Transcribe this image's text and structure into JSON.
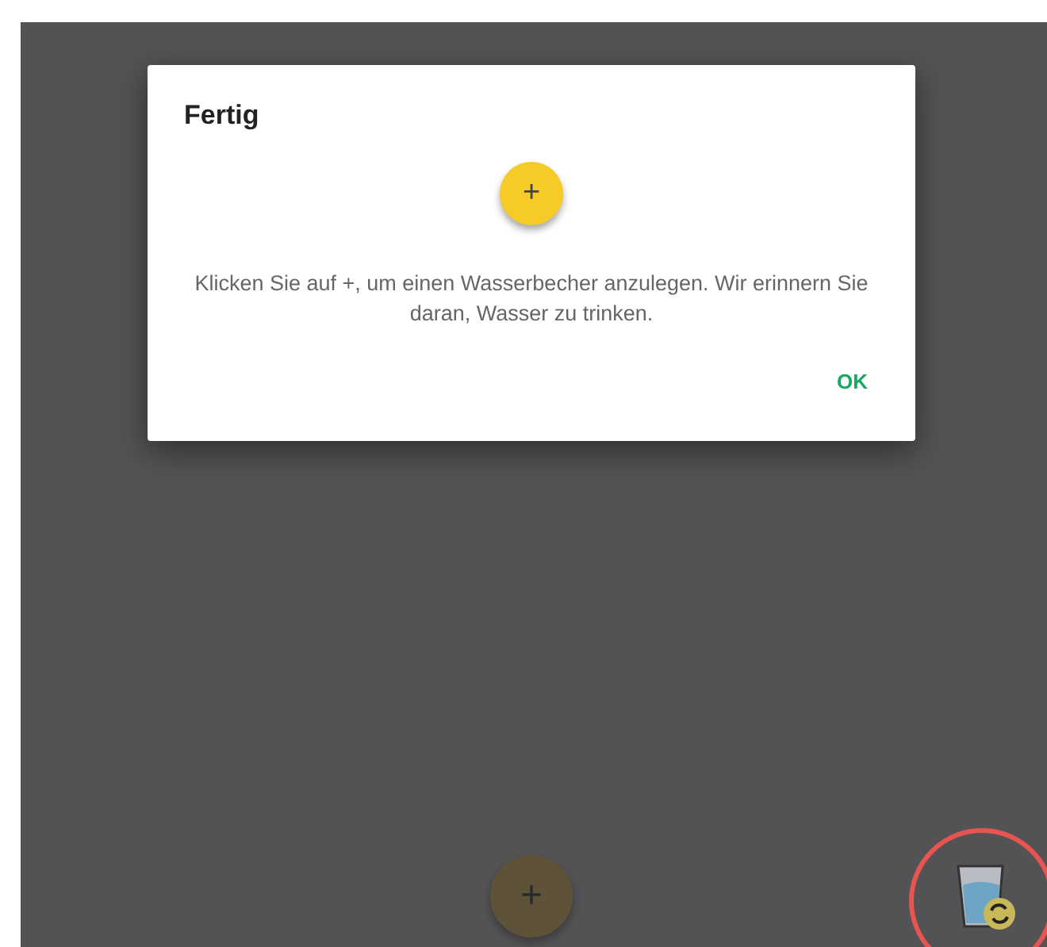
{
  "dialog": {
    "title": "Fertig",
    "icon_label": "+",
    "message": "Klicken Sie auf +, um einen Wasserbecher anzulegen. Wir erinnern Sie daran, Wasser zu trinken.",
    "buttons": [
      "OK"
    ]
  },
  "fab": {
    "label": "+"
  }
}
